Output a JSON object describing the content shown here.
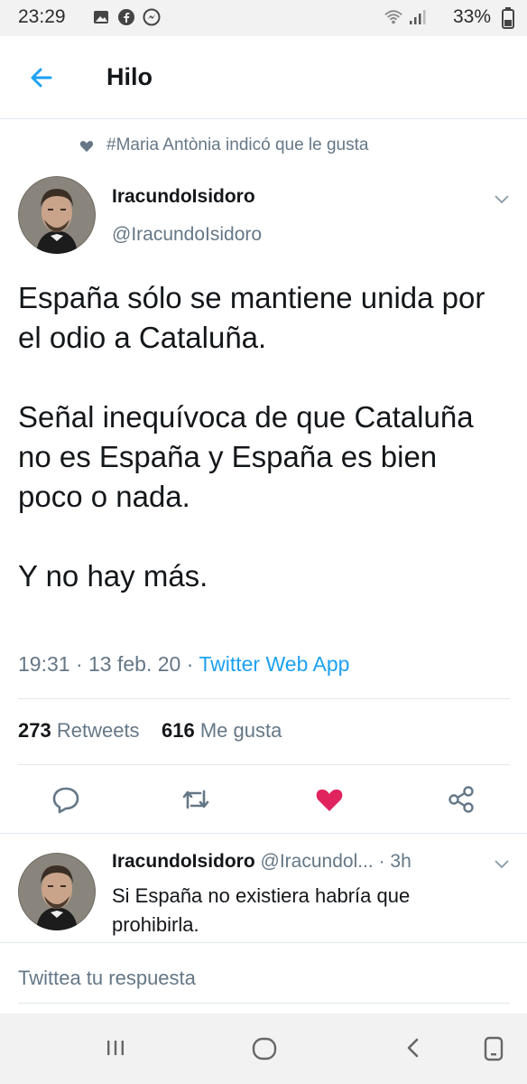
{
  "status_bar": {
    "time": "23:29",
    "battery": "33%",
    "icons": [
      "image-icon",
      "facebook-icon",
      "messenger-icon",
      "wifi-icon",
      "signal-icon",
      "battery-icon"
    ]
  },
  "header": {
    "title": "Hilo",
    "back_icon": "back-arrow-icon"
  },
  "liked_by": {
    "icon": "heart-icon",
    "text": "#Maria Antònia indicó que le gusta"
  },
  "tweet": {
    "display_name": "IracundoIsidoro",
    "handle": "@IracundoIsidoro",
    "paragraphs": [
      "España sólo se mantiene unida por el odio a Cataluña.",
      "Señal inequívoca de que Cataluña no es España y España es bien poco o nada.",
      "Y no hay más."
    ],
    "time": "19:31",
    "date": "13 feb. 20",
    "source": "Twitter Web App",
    "retweets_count": "273",
    "retweets_label": "Retweets",
    "likes_count": "616",
    "likes_label": "Me gusta",
    "liked": true,
    "colors": {
      "accent": "#1da1f2",
      "like": "#e0245e",
      "muted": "#657786"
    }
  },
  "actions": [
    "reply-icon",
    "retweet-icon",
    "like-icon",
    "share-icon"
  ],
  "reply": {
    "display_name": "IracundoIsidoro",
    "handle_truncated": "@Iracundol...",
    "age": "· 3h",
    "text": "Si España no existiera habría que prohibirla."
  },
  "compose": {
    "placeholder": "Twittea tu respuesta"
  },
  "nav_bar": [
    "recent-apps-icon",
    "home-icon",
    "back-icon",
    "assistant-icon"
  ]
}
